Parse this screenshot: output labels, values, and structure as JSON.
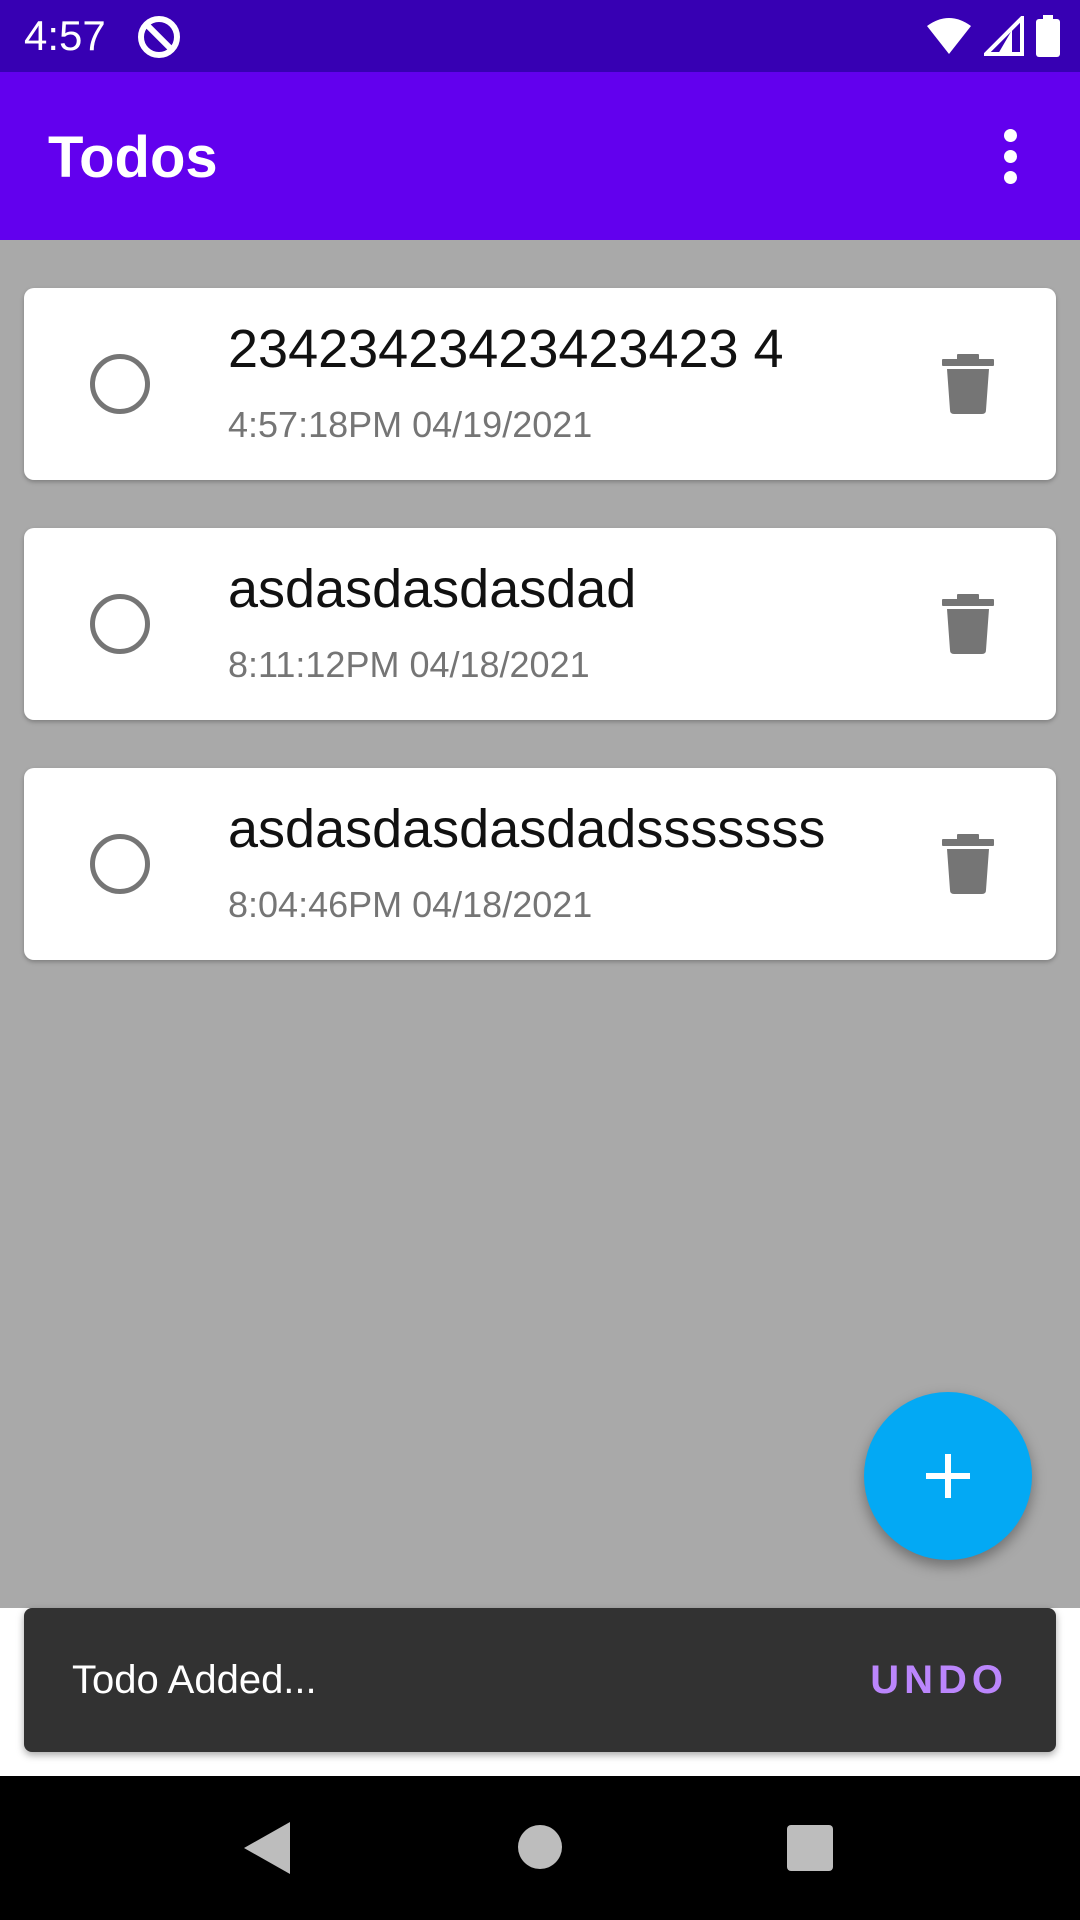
{
  "status_bar": {
    "time": "4:57",
    "icons": [
      "app-notification-icon",
      "wifi-icon",
      "cell-signal-icon",
      "battery-icon"
    ]
  },
  "app_bar": {
    "title": "Todos",
    "menu_icon": "more-vert-icon"
  },
  "todos": [
    {
      "title": "23423423423423423 4",
      "time": "4:57:18PM 04/19/2021",
      "done": false
    },
    {
      "title": "asdasdasdasdad",
      "time": "8:11:12PM 04/18/2021",
      "done": false
    },
    {
      "title": "asdasdasdasdadsssssss",
      "time": "8:04:46PM 04/18/2021",
      "done": false
    }
  ],
  "fab": {
    "icon": "plus-icon"
  },
  "snackbar": {
    "message": "Todo Added...",
    "action": "UNDO",
    "action_color": "#bb86fc"
  },
  "nav_bar": {
    "icons": [
      "back-icon",
      "home-icon",
      "recents-icon"
    ]
  },
  "colors": {
    "status_bar": "#3700b3",
    "app_bar": "#6200ee",
    "fab": "#03a9f4",
    "background": "#a9a9a9"
  }
}
